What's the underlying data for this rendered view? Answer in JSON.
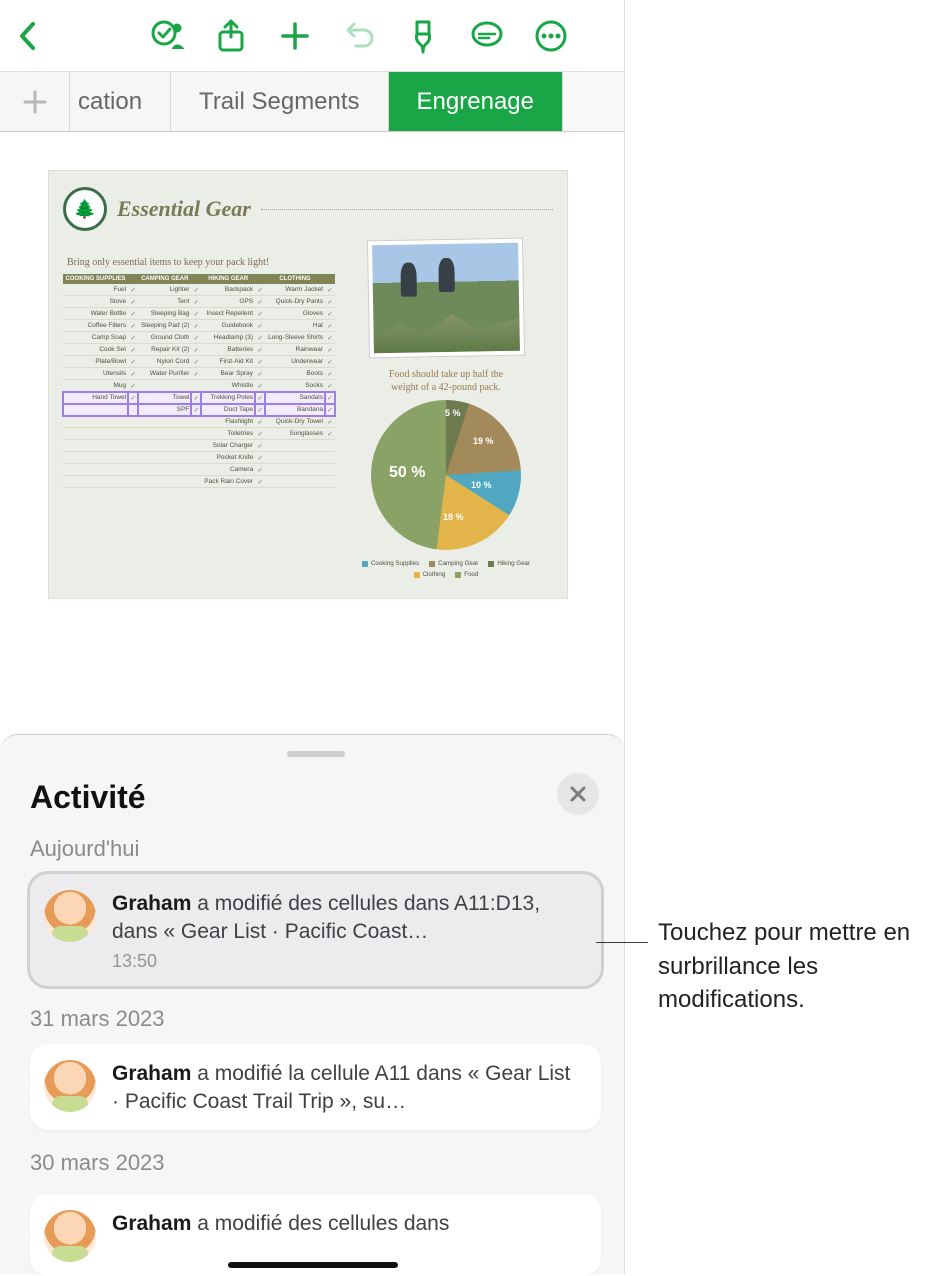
{
  "toolbar": {
    "icons": [
      "collaborate",
      "share",
      "add",
      "undo",
      "format-brush",
      "comment",
      "more"
    ]
  },
  "tabs": {
    "partial": "cation",
    "middle": "Trail Segments",
    "active": "Engrenage"
  },
  "sheet": {
    "title": "Essential Gear",
    "subtitle": "Bring only essential items to keep your pack light!",
    "headers": [
      "COOKING SUPPLIES",
      "CAMPING GEAR",
      "HIKING GEAR",
      "CLOTHING"
    ],
    "rows": [
      [
        "Fuel",
        "Lighter",
        "Backpack",
        "Warm Jacket"
      ],
      [
        "Stove",
        "Tent",
        "GPS",
        "Quick-Dry Pants"
      ],
      [
        "Water Bottle",
        "Sleeping Bag",
        "Insect Repellent",
        "Gloves"
      ],
      [
        "Coffee Filters",
        "Sleeping Pad (2)",
        "Guidebook",
        "Hat"
      ],
      [
        "Camp Soap",
        "Ground Cloth",
        "Headlamp (3)",
        "Long-Sleeve Shirts"
      ],
      [
        "Cook Set",
        "Repair Kit (2)",
        "Batteries",
        "Rainwear"
      ],
      [
        "Plate/Bowl",
        "Nylon Cord",
        "First-Aid Kit",
        "Underwear"
      ],
      [
        "Utensils",
        "Water Purifier",
        "Bear Spray",
        "Boots"
      ],
      [
        "Mug",
        "",
        "Whistle",
        "Socks"
      ],
      [
        "Hand Towel",
        "Towel",
        "Trekking Poles",
        "Sandals"
      ],
      [
        "",
        "SPF",
        "Duct Tape",
        "Bandana"
      ],
      [
        "",
        "",
        "Flashlight",
        "Quick-Dry Towel"
      ],
      [
        "",
        "",
        "Toiletries",
        "Sunglasses"
      ],
      [
        "",
        "",
        "Solar Charger",
        ""
      ],
      [
        "",
        "",
        "Pocket Knife",
        ""
      ],
      [
        "",
        "",
        "Camera",
        ""
      ],
      [
        "",
        "",
        "Pack Rain Cover",
        ""
      ]
    ],
    "caption1": "Food should take up half the",
    "caption2": "weight of a 42-pound pack.",
    "legend": [
      "Cooking Supplies",
      "Camping Gear",
      "Hiking Gear",
      "Clothing",
      "Food"
    ]
  },
  "chart_data": {
    "type": "pie",
    "title": "",
    "series": [
      {
        "name": "Food",
        "value": 50
      },
      {
        "name": "Hiking Gear",
        "value": 5
      },
      {
        "name": "Camping Gear",
        "value": 19
      },
      {
        "name": "Cooking Supplies",
        "value": 10
      },
      {
        "name": "Clothing",
        "value": 18
      }
    ],
    "labels": {
      "big": "50 %",
      "a": "5 %",
      "b": "19 %",
      "c": "10 %",
      "d": "18 %"
    }
  },
  "activity": {
    "title": "Activité",
    "today": "Aujourd'hui",
    "item1_who": "Graham",
    "item1_rest": " a modifié des cellules dans A11:D13, dans « Gear List · Pacific Coast…",
    "item1_time": "13:50",
    "date2": "31 mars 2023",
    "item2_who": "Graham",
    "item2_rest": " a modifié la cellule A11 dans « Gear List · Pacific Coast Trail Trip », su…",
    "date3": "30 mars 2023",
    "item3_who": "Graham",
    "item3_rest": " a modifié des cellules dans"
  },
  "callout": "Touchez pour mettre en surbrillance les modifications."
}
